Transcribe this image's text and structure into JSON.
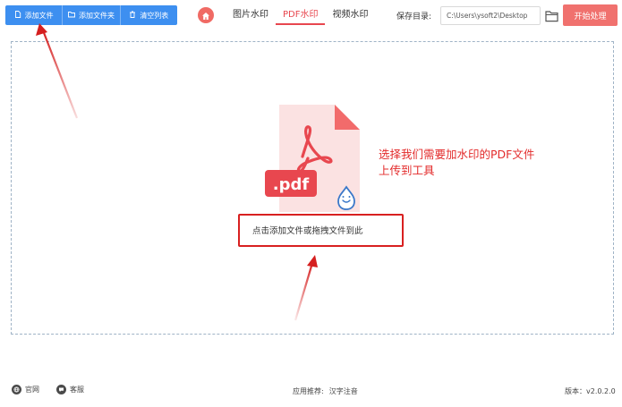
{
  "toolbar": {
    "add_file": "添加文件",
    "add_folder": "添加文件夹",
    "clear_list": "清空列表",
    "tabs": [
      {
        "label": "图片水印",
        "active": false
      },
      {
        "label": "PDF水印",
        "active": true
      },
      {
        "label": "视频水印",
        "active": false
      }
    ],
    "save_label": "保存目录:",
    "save_path": "C:\\Users\\ysoft2\\Desktop",
    "start_button": "开始处理"
  },
  "main": {
    "pdf_badge": ".pdf",
    "drop_hint": "点击添加文件或拖拽文件到此",
    "annotation_line1": "选择我们需要加水印的PDF文件",
    "annotation_line2": "上传到工具"
  },
  "footer": {
    "website": "官网",
    "support": "客服",
    "recommend_label": "应用推荐:",
    "recommend_app": "汉字注音",
    "version": "版本：v2.0.2.0"
  },
  "colors": {
    "primary_blue": "#3d8ff0",
    "accent_red": "#e8474f",
    "start_button": "#f0716e",
    "annotation_red": "#e32b2b",
    "file_body": "#fbe2e2",
    "file_badge": "#e8474f"
  },
  "icons": {
    "add_file": "file-icon",
    "add_folder": "folder-icon",
    "clear_list": "trash-icon",
    "home": "home-icon",
    "browse": "folder-open-icon",
    "pdf": "acrobat-icon",
    "drop": "water-drop-icon",
    "website": "globe-icon",
    "support": "chat-icon"
  }
}
